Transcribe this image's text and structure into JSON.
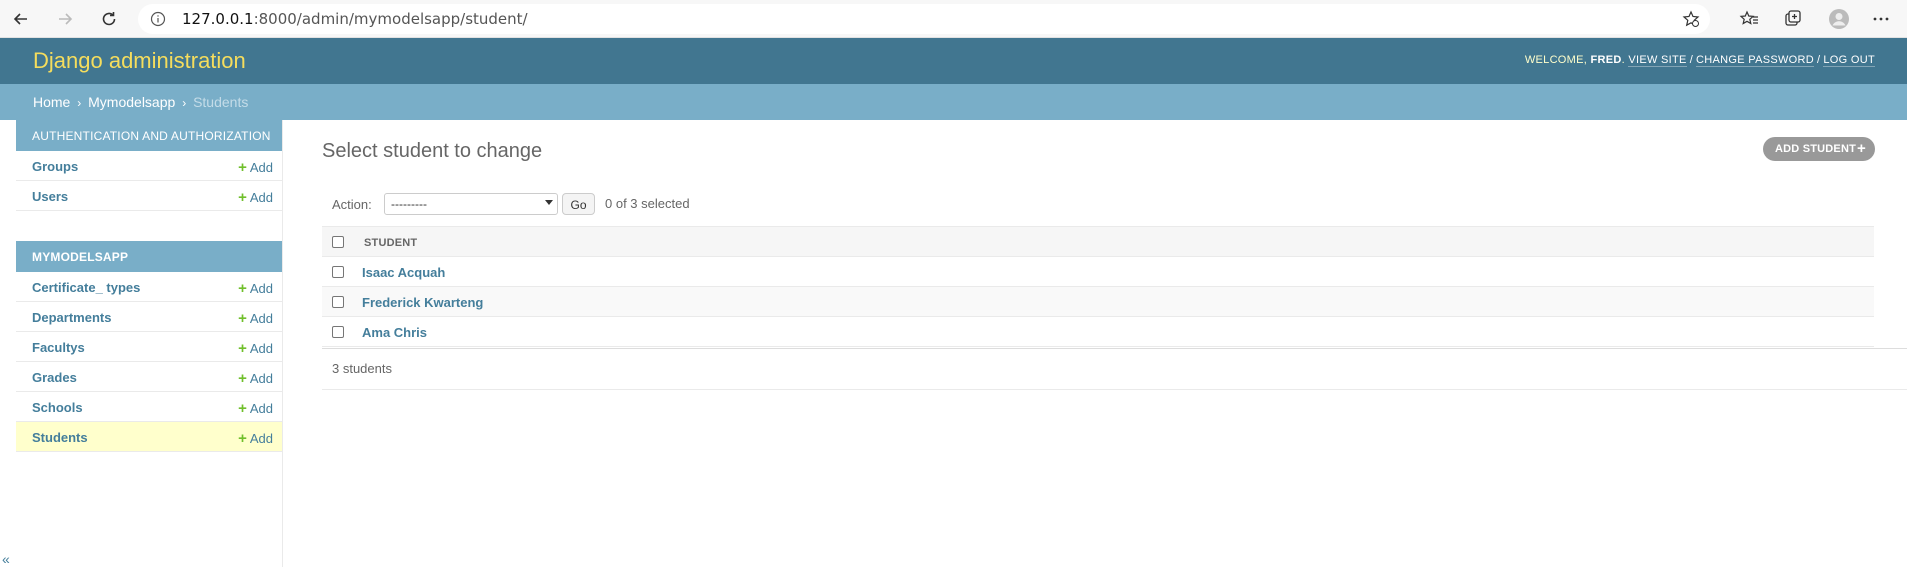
{
  "browser": {
    "url_host": "127.0.0.1",
    "url_rest": ":8000/admin/mymodelsapp/student/",
    "icons": [
      "back-arrow-icon",
      "forward-arrow-icon",
      "refresh-icon",
      "info-icon",
      "favorite-add-icon",
      "favorites-icon",
      "collections-icon",
      "profile-icon",
      "more-icon"
    ]
  },
  "header": {
    "branding": "Django administration",
    "welcome": "Welcome, ",
    "user": "Fred",
    "view_site": "View site",
    "change_password": "Change password",
    "log_out": "Log out",
    "sep": "/"
  },
  "breadcrumbs": {
    "home": "Home",
    "app": "Mymodelsapp",
    "current": "Students",
    "sep": "›"
  },
  "sidebar": {
    "modules": [
      {
        "caption": "Authentication and Authorization",
        "models": [
          {
            "name": "Groups",
            "add": "Add"
          },
          {
            "name": "Users",
            "add": "Add"
          }
        ]
      },
      {
        "caption": "Mymodelsapp",
        "models": [
          {
            "name": "Certificate_ types",
            "add": "Add"
          },
          {
            "name": "Departments",
            "add": "Add"
          },
          {
            "name": "Facultys",
            "add": "Add"
          },
          {
            "name": "Grades",
            "add": "Add"
          },
          {
            "name": "Schools",
            "add": "Add"
          },
          {
            "name": "Students",
            "add": "Add"
          }
        ]
      }
    ],
    "collapse_label": "«"
  },
  "content": {
    "title": "Select student to change",
    "add_button": "Add student",
    "actions": {
      "label": "Action:",
      "selected_option": "---------",
      "go": "Go",
      "count": "0 of 3 selected"
    },
    "table": {
      "column": "Student",
      "rows": [
        "Isaac Acquah",
        "Frederick Kwarteng",
        "Ama Chris"
      ]
    },
    "paginator": "3 students"
  },
  "colors": {
    "header": "#417690",
    "breadcrumbs": "#79aec8",
    "branding": "#f5dd5d",
    "link": "#447e9b",
    "add_plus": "#70bf2b",
    "current_row": "#ffffcc"
  }
}
